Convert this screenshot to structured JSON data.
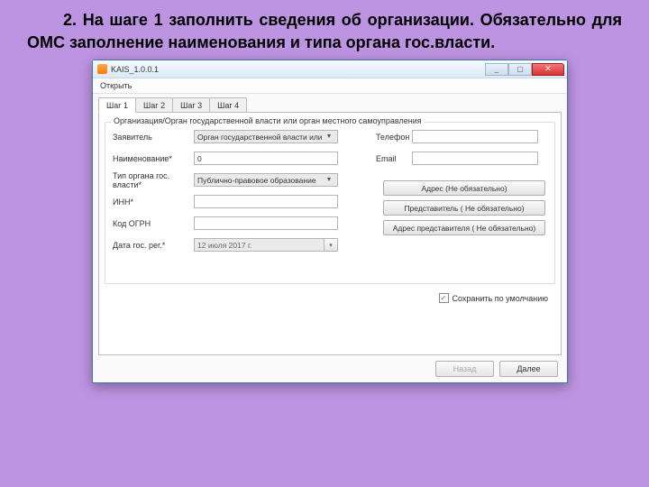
{
  "instruction": "2. На шаге 1 заполнить сведения об организации. Обязательно для ОМС заполнение наименования и типа органа гос.власти.",
  "window": {
    "title": "KAIS_1.0.0.1",
    "min": "_",
    "max": "▢",
    "close": "✕"
  },
  "menu": {
    "open": "Открыть"
  },
  "tabs": [
    "Шаг 1",
    "Шаг 2",
    "Шаг 3",
    "Шаг 4"
  ],
  "group_title": "Организация/Орган государственной власти или орган местного самоуправления",
  "labels": {
    "applicant": "Заявитель",
    "name": "Наименование*",
    "org_type": "Тип органа гос. власти*",
    "inn": "ИНН*",
    "ogrn": "Код ОГРН",
    "reg_date": "Дата гос. рег.*",
    "phone": "Телефон",
    "email": "Email"
  },
  "values": {
    "applicant": "Орган государственной власти или орг.",
    "name": "0",
    "org_type": "Публично-правовое образование",
    "inn": "",
    "ogrn": "",
    "reg_date": "12    июля    2017 г.",
    "phone": "",
    "email": ""
  },
  "buttons": {
    "address": "Адрес (Не обязательно)",
    "rep": "Представитель ( Не обязательно)",
    "rep_addr": "Адрес представителя ( Не обязательно)"
  },
  "checkbox": {
    "mark": "✓",
    "label": "Сохранить по умолчанию"
  },
  "nav": {
    "back": "Назад",
    "next": "Далее"
  }
}
